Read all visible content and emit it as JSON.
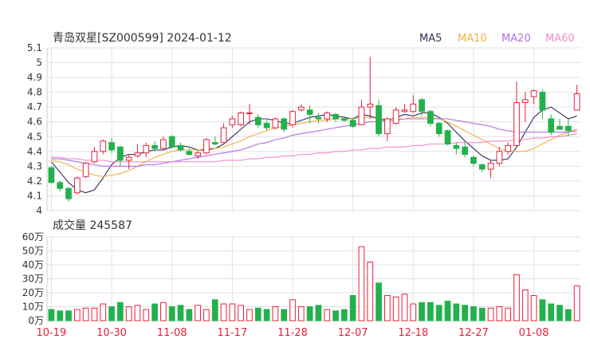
{
  "header": {
    "title": "青岛双星[SZ000599] 2024-01-12",
    "legend": [
      {
        "label": "MA5",
        "color": "#2f2f5f"
      },
      {
        "label": "MA10",
        "color": "#f0b040"
      },
      {
        "label": "MA20",
        "color": "#b070e0"
      },
      {
        "label": "MA60",
        "color": "#f08cc8"
      }
    ]
  },
  "colors": {
    "up": "#e8203c",
    "down": "#22b14c",
    "grid": "#e2e2e2",
    "axis_text": "#333333",
    "date_text": "#e8203c"
  },
  "chart_data": {
    "type": "candlestick",
    "price_axis": {
      "ylim": [
        4.0,
        5.1
      ],
      "ticks": [
        "5.1",
        "5",
        "4.9",
        "4.8",
        "4.7",
        "4.6",
        "4.5",
        "4.4",
        "4.3",
        "4.2",
        "4.1",
        "4"
      ]
    },
    "volume_axis": {
      "title": "成交量 245587",
      "ylim": [
        0,
        60
      ],
      "ticks": [
        "60万",
        "50万",
        "40万",
        "30万",
        "20万",
        "10万",
        "0万"
      ]
    },
    "date_labels": [
      "10-19",
      "10-30",
      "11-08",
      "11-17",
      "11-28",
      "12-07",
      "12-18",
      "12-27",
      "01-08"
    ],
    "date_label_index": [
      0,
      7,
      14,
      21,
      28,
      35,
      42,
      49,
      56
    ],
    "candles": [
      [
        4.29,
        4.19,
        4.3,
        4.18
      ],
      [
        4.19,
        4.15,
        4.2,
        4.13
      ],
      [
        4.15,
        4.08,
        4.16,
        4.06
      ],
      [
        4.12,
        4.22,
        4.23,
        4.11
      ],
      [
        4.23,
        4.32,
        4.33,
        4.22
      ],
      [
        4.33,
        4.4,
        4.43,
        4.32
      ],
      [
        4.4,
        4.47,
        4.48,
        4.38
      ],
      [
        4.46,
        4.41,
        4.49,
        4.39
      ],
      [
        4.43,
        4.34,
        4.44,
        4.3
      ],
      [
        4.34,
        4.36,
        4.38,
        4.28
      ],
      [
        4.37,
        4.39,
        4.45,
        4.36
      ],
      [
        4.39,
        4.44,
        4.46,
        4.36
      ],
      [
        4.44,
        4.42,
        4.47,
        4.4
      ],
      [
        4.42,
        4.48,
        4.5,
        4.41
      ],
      [
        4.5,
        4.43,
        4.51,
        4.42
      ],
      [
        4.44,
        4.41,
        4.46,
        4.4
      ],
      [
        4.4,
        4.38,
        4.42,
        4.37
      ],
      [
        4.37,
        4.39,
        4.41,
        4.35
      ],
      [
        4.39,
        4.48,
        4.49,
        4.38
      ],
      [
        4.46,
        4.45,
        4.5,
        4.44
      ],
      [
        4.46,
        4.56,
        4.59,
        4.46
      ],
      [
        4.58,
        4.62,
        4.64,
        4.56
      ],
      [
        4.58,
        4.66,
        4.67,
        4.57
      ],
      [
        4.66,
        4.66,
        4.72,
        4.58
      ],
      [
        4.63,
        4.58,
        4.65,
        4.56
      ],
      [
        4.59,
        4.56,
        4.61,
        4.54
      ],
      [
        4.56,
        4.62,
        4.63,
        4.55
      ],
      [
        4.62,
        4.55,
        4.63,
        4.53
      ],
      [
        4.58,
        4.67,
        4.68,
        4.56
      ],
      [
        4.68,
        4.7,
        4.72,
        4.67
      ],
      [
        4.68,
        4.65,
        4.71,
        4.59
      ],
      [
        4.63,
        4.62,
        4.66,
        4.59
      ],
      [
        4.62,
        4.66,
        4.67,
        4.6
      ],
      [
        4.65,
        4.62,
        4.66,
        4.6
      ],
      [
        4.62,
        4.61,
        4.64,
        4.6
      ],
      [
        4.61,
        4.57,
        4.63,
        4.56
      ],
      [
        4.58,
        4.7,
        4.75,
        4.58
      ],
      [
        4.7,
        4.72,
        5.04,
        4.62
      ],
      [
        4.71,
        4.52,
        4.75,
        4.5
      ],
      [
        4.52,
        4.62,
        4.63,
        4.47
      ],
      [
        4.59,
        4.68,
        4.7,
        4.58
      ],
      [
        4.67,
        4.68,
        4.72,
        4.66
      ],
      [
        4.67,
        4.72,
        4.78,
        4.66
      ],
      [
        4.75,
        4.67,
        4.76,
        4.64
      ],
      [
        4.67,
        4.59,
        4.68,
        4.57
      ],
      [
        4.59,
        4.52,
        4.6,
        4.5
      ],
      [
        4.54,
        4.45,
        4.55,
        4.44
      ],
      [
        4.44,
        4.42,
        4.46,
        4.38
      ],
      [
        4.43,
        4.38,
        4.46,
        4.36
      ],
      [
        4.36,
        4.32,
        4.37,
        4.3
      ],
      [
        4.31,
        4.28,
        4.32,
        4.26
      ],
      [
        4.28,
        4.32,
        4.34,
        4.22
      ],
      [
        4.32,
        4.4,
        4.43,
        4.3
      ],
      [
        4.4,
        4.44,
        4.46,
        4.38
      ],
      [
        4.44,
        4.73,
        4.87,
        4.43
      ],
      [
        4.73,
        4.75,
        4.8,
        4.6
      ],
      [
        4.77,
        4.81,
        4.82,
        4.72
      ],
      [
        4.8,
        4.68,
        4.82,
        4.62
      ],
      [
        4.62,
        4.53,
        4.65,
        4.51
      ],
      [
        4.57,
        4.55,
        4.62,
        4.55
      ],
      [
        4.57,
        4.54,
        4.62,
        4.5
      ],
      [
        4.68,
        4.79,
        4.85,
        4.68
      ]
    ],
    "volumes": [
      8,
      7,
      7,
      8,
      9,
      9,
      12,
      10,
      13,
      10,
      11,
      8,
      12,
      13,
      10,
      11,
      8,
      11,
      8,
      15,
      12,
      12,
      11,
      8,
      9,
      8,
      10,
      8,
      15,
      10,
      10,
      11,
      8,
      7,
      8,
      18,
      53,
      42,
      27,
      18,
      17,
      19,
      12,
      13,
      13,
      11,
      14,
      12,
      11,
      10,
      9,
      9,
      10,
      9,
      33,
      22,
      18,
      15,
      12,
      11,
      8,
      25
    ],
    "ma": {
      "MA5": [
        4.33,
        4.26,
        4.19,
        4.14,
        4.12,
        4.14,
        4.22,
        4.31,
        4.36,
        4.38,
        4.38,
        4.4,
        4.41,
        4.41,
        4.43,
        4.44,
        4.43,
        4.41,
        4.41,
        4.42,
        4.45,
        4.5,
        4.55,
        4.6,
        4.62,
        4.62,
        4.61,
        4.59,
        4.59,
        4.61,
        4.63,
        4.64,
        4.65,
        4.64,
        4.63,
        4.62,
        4.65,
        4.64,
        4.62,
        4.61,
        4.63,
        4.65,
        4.64,
        4.66,
        4.66,
        4.63,
        4.59,
        4.53,
        4.47,
        4.42,
        4.37,
        4.34,
        4.34,
        4.35,
        4.43,
        4.53,
        4.63,
        4.68,
        4.7,
        4.66,
        4.62,
        4.64
      ],
      "MA10": [
        4.34,
        4.33,
        4.31,
        4.28,
        4.26,
        4.24,
        4.23,
        4.24,
        4.25,
        4.27,
        4.3,
        4.33,
        4.36,
        4.38,
        4.4,
        4.41,
        4.41,
        4.41,
        4.42,
        4.42,
        4.43,
        4.45,
        4.47,
        4.5,
        4.52,
        4.54,
        4.56,
        4.57,
        4.58,
        4.59,
        4.6,
        4.61,
        4.61,
        4.62,
        4.62,
        4.62,
        4.63,
        4.63,
        4.62,
        4.62,
        4.62,
        4.62,
        4.63,
        4.63,
        4.63,
        4.62,
        4.6,
        4.57,
        4.54,
        4.51,
        4.48,
        4.45,
        4.42,
        4.4,
        4.4,
        4.4,
        4.42,
        4.45,
        4.48,
        4.51,
        4.53,
        4.55
      ],
      "MA20": [
        4.35,
        4.35,
        4.34,
        4.33,
        4.32,
        4.31,
        4.3,
        4.3,
        4.3,
        4.3,
        4.3,
        4.31,
        4.31,
        4.32,
        4.33,
        4.34,
        4.35,
        4.36,
        4.37,
        4.38,
        4.39,
        4.4,
        4.41,
        4.43,
        4.45,
        4.46,
        4.48,
        4.49,
        4.51,
        4.52,
        4.53,
        4.54,
        4.55,
        4.56,
        4.57,
        4.58,
        4.59,
        4.6,
        4.6,
        4.61,
        4.61,
        4.62,
        4.62,
        4.62,
        4.62,
        4.62,
        4.62,
        4.61,
        4.6,
        4.59,
        4.58,
        4.57,
        4.55,
        4.54,
        4.53,
        4.53,
        4.53,
        4.53,
        4.53,
        4.53,
        4.53,
        4.54
      ],
      "MA60": [
        4.36,
        4.36,
        4.35,
        4.35,
        4.34,
        4.34,
        4.34,
        4.33,
        4.33,
        4.33,
        4.33,
        4.33,
        4.33,
        4.33,
        4.33,
        4.33,
        4.33,
        4.33,
        4.33,
        4.33,
        4.34,
        4.34,
        4.34,
        4.35,
        4.35,
        4.36,
        4.36,
        4.37,
        4.37,
        4.38,
        4.38,
        4.39,
        4.39,
        4.4,
        4.4,
        4.41,
        4.41,
        4.42,
        4.42,
        4.43,
        4.43,
        4.43,
        4.44,
        4.44,
        4.45,
        4.45,
        4.45,
        4.46,
        4.46,
        4.46,
        4.46,
        4.47,
        4.47,
        4.47,
        4.48,
        4.48,
        4.49,
        4.49,
        4.5,
        4.5,
        4.51,
        4.52
      ]
    }
  }
}
